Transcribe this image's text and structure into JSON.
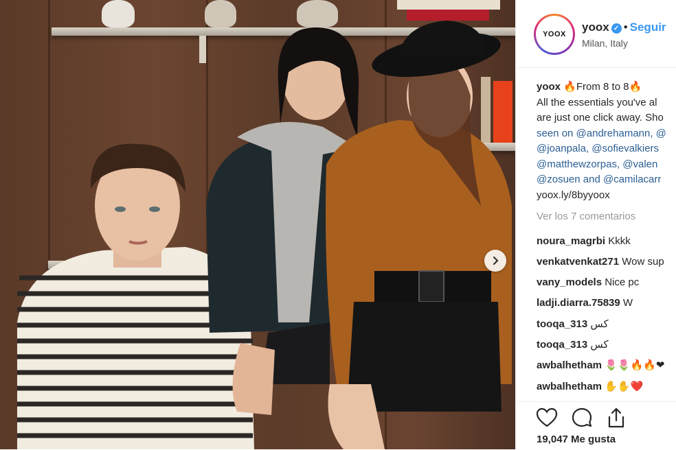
{
  "post": {
    "account": {
      "avatar_text": "YOOX",
      "username": "yoox",
      "verified_icon": "verified-badge-icon",
      "separator": "•",
      "follow_label": "Seguir",
      "location": "Milan, Italy"
    },
    "caption": {
      "username": "yoox",
      "lines": [
        "🔥From 8 to 8🔥",
        "All the essentials you've al",
        "are just one click away. Sho",
        "seen on @andrehamann, @",
        "@joanpala, @sofievalkiers",
        "@matthewzorpas, @valen",
        "@zosuen and @camilacarr",
        "yoox.ly/8byyoox"
      ]
    },
    "view_all_comments": "Ver los 7 comentarios",
    "comments": [
      {
        "user": "noura_magrbi",
        "text": "Kkkk"
      },
      {
        "user": "venkatvenkat271",
        "text": "Wow sup"
      },
      {
        "user": "vany_models",
        "text": "Nice pc"
      },
      {
        "user": "ladji.diarra.75839",
        "text": "W"
      },
      {
        "user": "tooqa_313",
        "text": "كس"
      },
      {
        "user": "tooqa_313",
        "text": "كس"
      },
      {
        "user": "awbalhetham",
        "text": "🌷🌷🔥🔥❤"
      },
      {
        "user": "awbalhetham",
        "text": "✋✋❤️"
      }
    ],
    "likes": "19,047 Me gusta",
    "icons": {
      "like": "heart-icon",
      "comment": "comment-bubble-icon",
      "share": "share-icon",
      "next": "chevron-right-icon"
    }
  }
}
